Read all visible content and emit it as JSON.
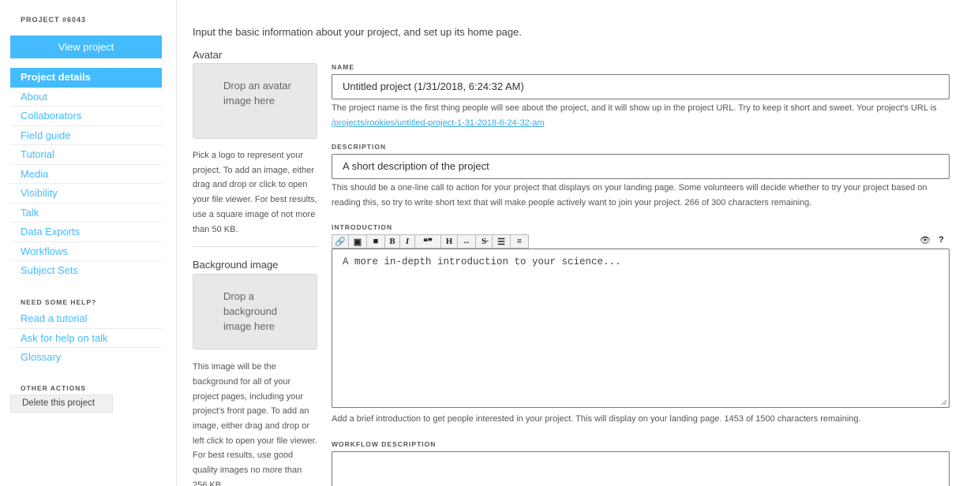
{
  "sidebar": {
    "project_number": "PROJECT #6043",
    "view_project": "View project",
    "items": [
      {
        "label": "Project details"
      },
      {
        "label": "About"
      },
      {
        "label": "Collaborators"
      },
      {
        "label": "Field guide"
      },
      {
        "label": "Tutorial"
      },
      {
        "label": "Media"
      },
      {
        "label": "Visibility"
      },
      {
        "label": "Talk"
      },
      {
        "label": "Data Exports"
      },
      {
        "label": "Workflows"
      },
      {
        "label": "Subject Sets"
      }
    ],
    "help_heading": "NEED SOME HELP?",
    "help_items": [
      {
        "label": "Read a tutorial"
      },
      {
        "label": "Ask for help on talk"
      },
      {
        "label": "Glossary"
      }
    ],
    "other_heading": "OTHER ACTIONS",
    "delete_label": "Delete this project"
  },
  "main": {
    "intro": "Input the basic information about your project, and set up its home page.",
    "avatar": {
      "title": "Avatar",
      "dropzone": "Drop an avatar image here",
      "help": "Pick a logo to represent your project. To add an image, either drag and drop or click to open your file viewer. For best results, use a square image of not more than 50 KB."
    },
    "background": {
      "title": "Background image",
      "dropzone": "Drop a background image here",
      "help": "This image will be the background for all of your project pages, including your project's front page. To add an image, either drag and drop or left click to open your file viewer. For best results, use good quality images no more than 256 KB."
    },
    "name": {
      "label": "NAME",
      "value": "Untitled project (1/31/2018, 6:24:32 AM)",
      "help": "The project name is the first thing people will see about the project, and it will show up in the project URL. Try to keep it short and sweet. Your project's URL is",
      "url": "/projects/rookies/untitled-project-1-31-2018-6-24-32-am"
    },
    "description": {
      "label": "DESCRIPTION",
      "value": "A short description of the project",
      "help": "This should be a one-line call to action for your project that displays on your landing page. Some volunteers will decide whether to try your project based on reading this, so try to write short text that will make people actively want to join your project. 266 of 300 characters remaining."
    },
    "introduction": {
      "label": "INTRODUCTION",
      "placeholder": "A more in-depth introduction to your science...",
      "help": "Add a brief introduction to get people interested in your project. This will display on your landing page. 1453 of 1500 characters remaining.",
      "toolbar": [
        {
          "name": "link-icon",
          "glyph": "🔗"
        },
        {
          "name": "image-icon",
          "glyph": "▣"
        },
        {
          "name": "video-icon",
          "glyph": "■"
        },
        {
          "name": "bold-icon",
          "glyph": "B"
        },
        {
          "name": "italic-icon",
          "glyph": "I"
        },
        {
          "name": "quote-icon",
          "glyph": "❝❞"
        },
        {
          "name": "heading-icon",
          "glyph": "H"
        },
        {
          "name": "hrule-icon",
          "glyph": "↔"
        },
        {
          "name": "strikethrough-icon",
          "glyph": "S̶"
        },
        {
          "name": "bullet-list-icon",
          "glyph": "☰"
        },
        {
          "name": "numbered-list-icon",
          "glyph": "≡"
        }
      ],
      "preview_glyph": "👁",
      "help_glyph": "?"
    },
    "workflow_description": {
      "label": "WORKFLOW DESCRIPTION"
    }
  }
}
